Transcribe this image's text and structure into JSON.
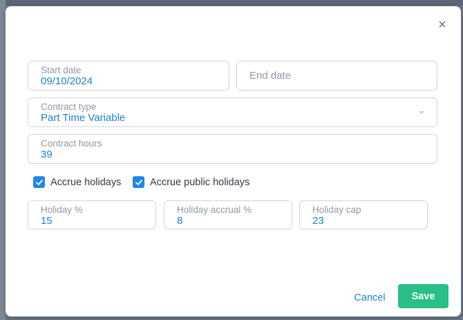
{
  "dialog": {
    "close_label": "×",
    "start_date": {
      "label": "Start date",
      "value": "09/10/2024"
    },
    "end_date": {
      "placeholder": "End date"
    },
    "contract_type": {
      "label": "Contract type",
      "value": "Part Time Variable"
    },
    "contract_hours": {
      "label": "Contract hours",
      "value": "39"
    },
    "accrue_holidays": {
      "label": "Accrue holidays",
      "checked": true
    },
    "accrue_public_holidays": {
      "label": "Accrue public holidays",
      "checked": true
    },
    "holiday_percent": {
      "label": "Holiday %",
      "value": "15"
    },
    "holiday_accrual_percent": {
      "label": "Holiday accrual %",
      "value": "8"
    },
    "holiday_cap": {
      "label": "Holiday cap",
      "value": "23"
    },
    "cancel_label": "Cancel",
    "save_label": "Save"
  },
  "colors": {
    "accent": "#1e88e5",
    "save": "#2abf86",
    "backdrop": "#6d7786"
  }
}
